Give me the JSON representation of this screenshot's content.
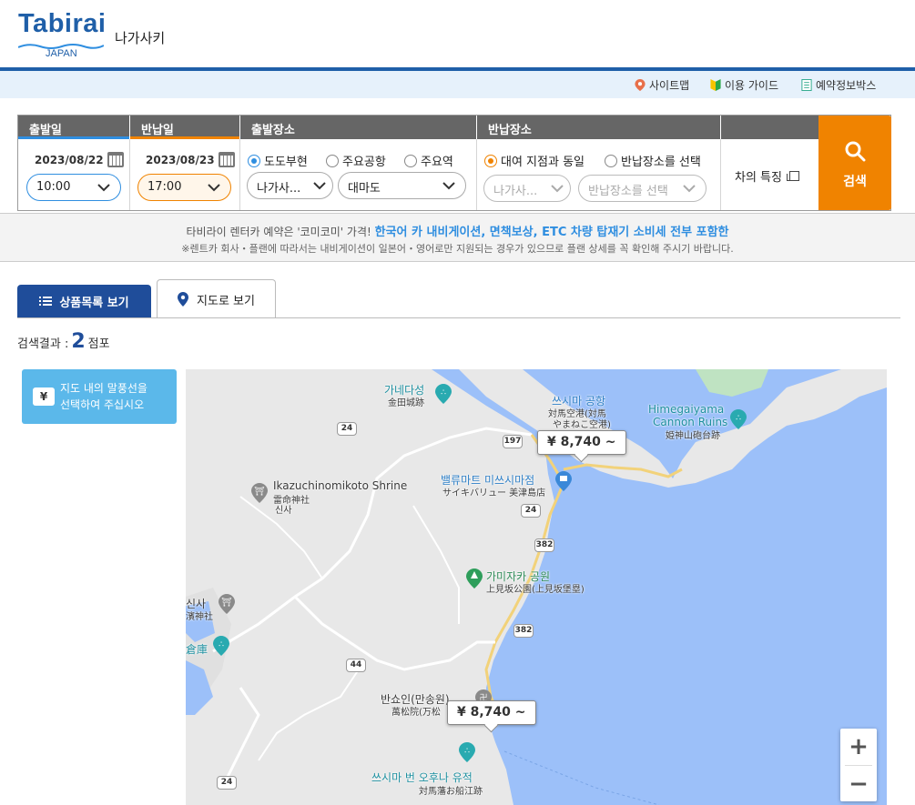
{
  "header": {
    "logo_text": "Tabirai",
    "logo_sub": "JAPAN",
    "city": "나가사키"
  },
  "utilbar": {
    "sitemap": "사이트맵",
    "guide": "이용 가이드",
    "booking_box": "예약정보박스"
  },
  "search": {
    "depart_date_head": "출발일",
    "return_date_head": "반납일",
    "depart_place_head": "출발장소",
    "return_place_head": "반납장소",
    "depart_date": "2023/08/22",
    "return_date": "2023/08/23",
    "depart_time": "10:00",
    "return_time": "17:00",
    "depart_radios": [
      "도도부현",
      "주요공항",
      "주요역"
    ],
    "depart_pref": "나가사...",
    "depart_area": "대마도",
    "return_radios": [
      "대여 지점과 동일",
      "반납장소를 선택"
    ],
    "return_pref": "나가사...",
    "return_place": "반납장소를 선택",
    "feature": "차의 특징",
    "button": "검색"
  },
  "notice": {
    "line1_prefix": "타비라이 렌터카 예약은 '코미코미' 가격!",
    "line1_highlight": "한국어 카 내비게이션, 면책보상, ETC 차량 탑재기 소비세 전부 포함한",
    "line2": "※렌트카 회사・플랜에 따라서는 내비게이션이 일본어・영어로만 지원되는 경우가 있으므로 플랜 상세를 꼭 확인해 주시기 바랍니다."
  },
  "tabs": {
    "list": "상품목록 보기",
    "map": "지도로 보기"
  },
  "result": {
    "prefix": "검색결과 :",
    "count": "2",
    "suffix": "점포"
  },
  "hint": {
    "yen": "¥",
    "line1": "지도 내의 말풍선을",
    "line2": "선택하여 주십시오"
  },
  "map": {
    "labels": {
      "kanedajo": "가네다성",
      "kanedajo_jp": "金田城跡",
      "airport": "쓰시마 공항",
      "airport_jp1": "対馬空港(対馬",
      "airport_jp2": "やまねこ空港)",
      "himegami": "Himegaiyama",
      "himegami2": "Cannon Ruins",
      "himegami_jp": "姫神山砲台跡",
      "ikazuchi": "Ikazuchinomikoto Shrine",
      "ikazuchi_jp1": "雷命神社",
      "ikazuchi_jp2": "신사",
      "value": "밸류마트 미쓰시마점",
      "value_jp": "サイキバリュー 美津島店",
      "kamisaka": "가미자카 공원",
      "kamisaka_jp": "上見坂公園(上見坂堡塁)",
      "shrine_left": "신사",
      "shrine_left_jp": "濱神社",
      "warehouse": "倉庫",
      "banshoin": "반쇼인(만송원)",
      "banshoin_jp": "萬松院(万松",
      "funae": "쓰시마 번 오후나 유적",
      "funae_jp": "対馬藩お船江跡"
    },
    "routes": [
      "24",
      "197",
      "24",
      "382",
      "382",
      "44",
      "24"
    ],
    "balloons": [
      "¥ 8,740 ~",
      "¥ 8,740 ~"
    ],
    "zoom_in": "+",
    "zoom_out": "−"
  }
}
